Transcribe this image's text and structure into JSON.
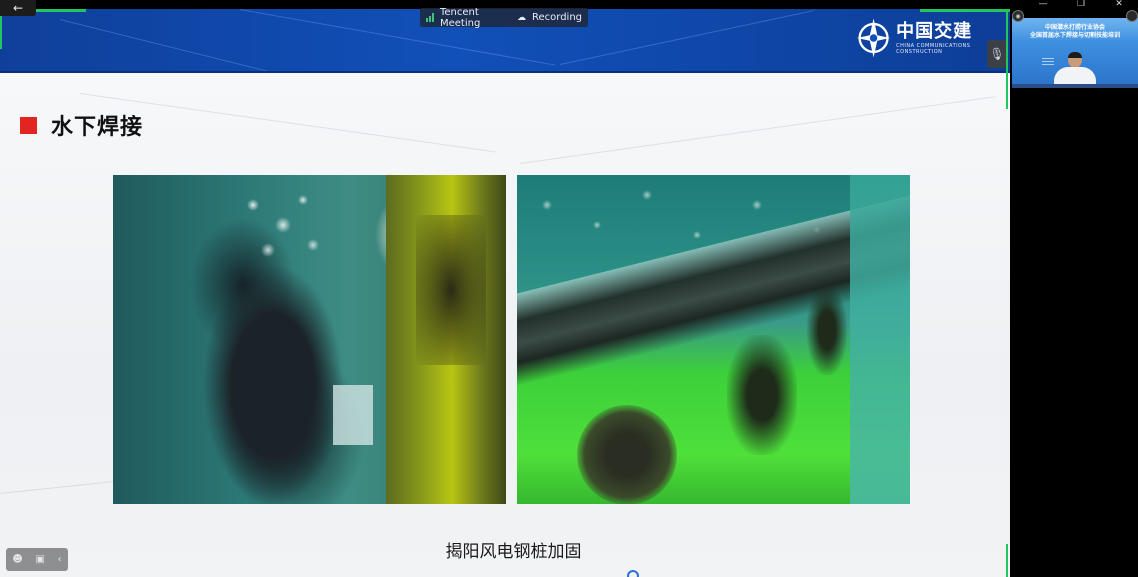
{
  "window": {
    "controls": {
      "minimize": "—",
      "restore": "❐",
      "close": "✕"
    },
    "back_icon": "←"
  },
  "meeting_status": {
    "app_name": "Tencent Meeting",
    "recording_label": "Recording",
    "recording_icon": "☁"
  },
  "slide": {
    "logo_text": "中国交建",
    "logo_subtext": "CHINA COMMUNICATIONS CONSTRUCTION",
    "title": "水下焊接",
    "caption": "揭阳风电钢桩加固",
    "accent_color": "#e32521",
    "header_color": "#1150b8"
  },
  "mic_icon": "🎙",
  "toolbar": {
    "items": [
      "☻",
      "▣",
      "‹"
    ]
  },
  "participant_video": {
    "banner_line1": "中国潜水打捞行业协会",
    "banner_line2": "全国首届水下焊接与切割技能培训"
  }
}
